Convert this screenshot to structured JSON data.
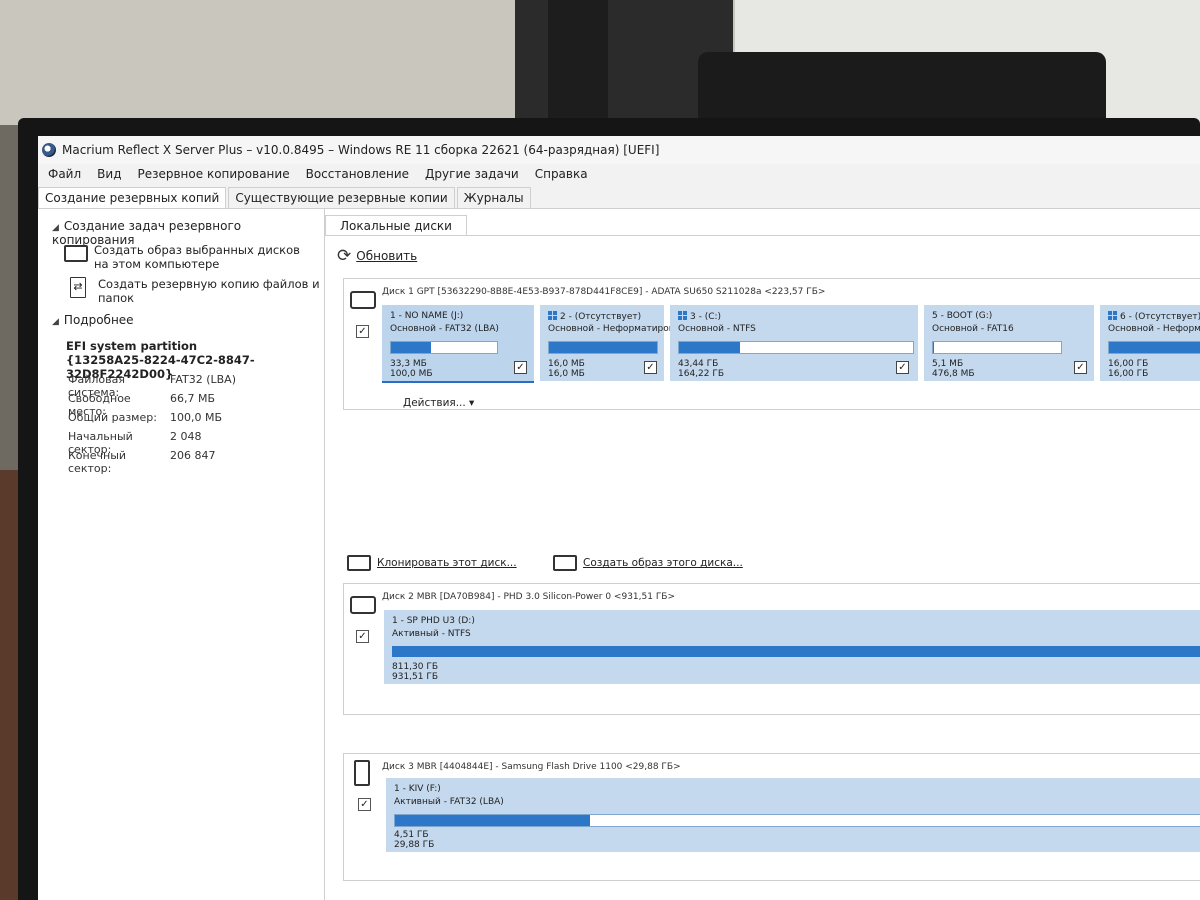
{
  "window": {
    "title": "Macrium Reflect X Server Plus – v10.0.8495 – Windows RE 11 сборка 22621 (64-разрядная)  [UEFI]"
  },
  "menu": [
    "Файл",
    "Вид",
    "Резервное копирование",
    "Восстановление",
    "Другие задачи",
    "Справка"
  ],
  "tabs": [
    {
      "label": "Создание резервных копий",
      "active": true
    },
    {
      "label": "Существующие резервные копии",
      "active": false
    },
    {
      "label": "Журналы",
      "active": false
    }
  ],
  "left": {
    "tasks_header": "Создание задач резервного копирования",
    "task_image": "Создать образ выбранных дисков на этом компьютере",
    "task_files": "Создать резервную копию файлов и папок",
    "details_header": "Подробнее",
    "partition_name": "EFI system partition",
    "partition_guid": "{13258A25-8224-47C2-8847-32D8F2242D00}",
    "info": [
      {
        "key": "Файловая система:",
        "value": "FAT32 (LBA)"
      },
      {
        "key": "Свободное место:",
        "value": "66,7 МБ"
      },
      {
        "key": "Общий размер:",
        "value": "100,0 МБ"
      },
      {
        "key": "Начальный сектор:",
        "value": "2 048"
      },
      {
        "key": "Конечный сектор:",
        "value": "206 847"
      }
    ]
  },
  "right": {
    "tab": "Локальные диски",
    "refresh": "Обновить",
    "actions": "Действия... ▾",
    "clone_link": "Клонировать этот диск...",
    "image_link": "Создать образ этого диска...",
    "disks": [
      {
        "header": "Диск 1 GPT [53632290-8B8E-4E53-B937-878D441F8CE9] - ADATA SU650 S211028a  <223,57 ГБ>",
        "partitions": [
          {
            "name": "1 - NO NAME (J:)",
            "type": "Основной - FAT32 (LBA)",
            "used": "33,3 МБ",
            "total": "100,0 МБ",
            "fill": 0.33,
            "checked": true,
            "selected": true
          },
          {
            "name": "2 - (Отсутствует)",
            "type": "Основной - Неформатированный",
            "used": "16,0 МБ",
            "total": "16,0 МБ",
            "fill": 1.0,
            "checked": true
          },
          {
            "name": "3 - (C:)",
            "type": "Основной - NTFS",
            "used": "43,44 ГБ",
            "total": "164,22 ГБ",
            "fill": 0.26,
            "checked": true
          },
          {
            "name": "5 - BOOT (G:)",
            "type": "Основной - FAT16",
            "used": "5,1 МБ",
            "total": "476,8 МБ",
            "fill": 0.01,
            "checked": true
          },
          {
            "name": "6 - (Отсутствует)",
            "type": "Основной - Неформатированный",
            "used": "16,00 ГБ",
            "total": "16,00 ГБ",
            "fill": 1.0,
            "checked": true
          }
        ]
      },
      {
        "header": "Диск 2 MBR [DA70B984] - PHD 3.0  Silicon-Power   0  <931,51 ГБ>",
        "partitions": [
          {
            "name": "1 - SP PHD U3 (D:)",
            "type": "Активный - NTFS",
            "used": "811,30 ГБ",
            "total": "931,51 ГБ",
            "fill": 0.87,
            "checked": true
          }
        ]
      },
      {
        "header": "Диск 3 MBR [4404844E] - Samsung  Flash Drive     1100  <29,88 ГБ>",
        "partitions": [
          {
            "name": "1 - KIV (F:)",
            "type": "Активный - FAT32 (LBA)",
            "used": "4,51 ГБ",
            "total": "29,88 ГБ",
            "fill": 0.15,
            "checked": true
          }
        ]
      }
    ]
  },
  "colors": {
    "accent": "#2c77c8",
    "partition_bg": "#c4d9ee"
  }
}
